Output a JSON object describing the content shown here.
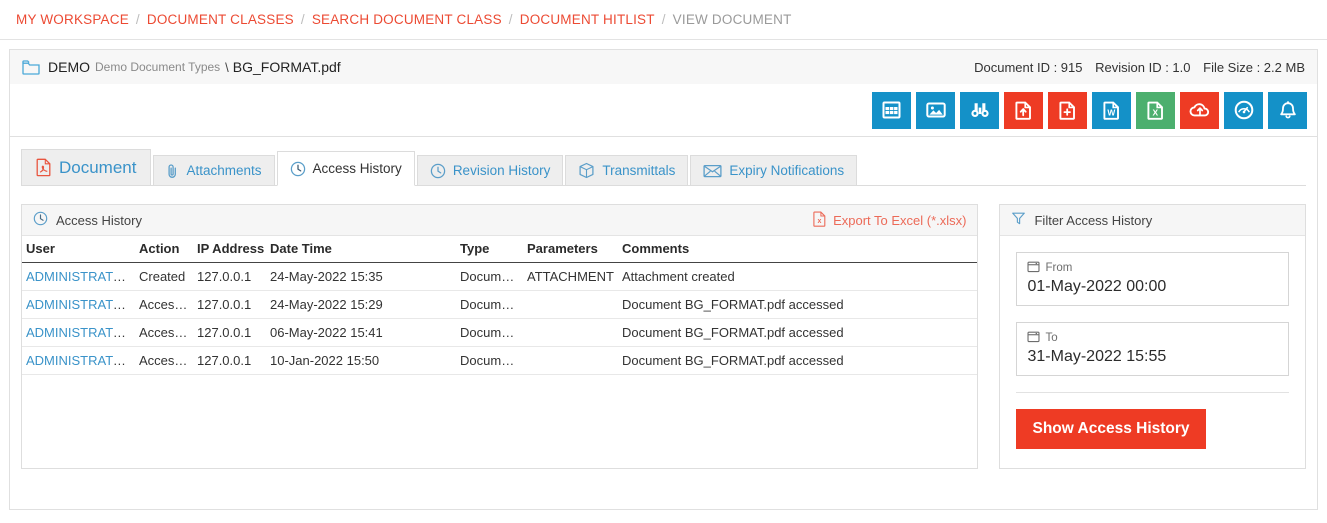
{
  "breadcrumb": {
    "items": [
      {
        "label": "MY WORKSPACE",
        "current": false
      },
      {
        "label": "DOCUMENT CLASSES",
        "current": false
      },
      {
        "label": "SEARCH DOCUMENT CLASS",
        "current": false
      },
      {
        "label": "DOCUMENT HITLIST",
        "current": false
      },
      {
        "label": "VIEW DOCUMENT",
        "current": true
      }
    ],
    "separator": "/"
  },
  "doc_header": {
    "folder_icon": "folder-icon",
    "class_code": "DEMO",
    "class_name": "Demo Document Types",
    "separator": "\\",
    "file_name": "BG_FORMAT.pdf",
    "document_id_label": "Document ID : 915",
    "revision_id_label": "Revision ID : 1.0",
    "file_size_label": "File Size : 2.2 MB"
  },
  "toolbar": {
    "buttons": [
      {
        "name": "table-grid-icon",
        "color": "#1491c8"
      },
      {
        "name": "image-icon",
        "color": "#1491c8"
      },
      {
        "name": "binoculars-icon",
        "color": "#1491c8"
      },
      {
        "name": "file-upload-icon",
        "color": "#ee3b24"
      },
      {
        "name": "file-add-icon",
        "color": "#ee3b24"
      },
      {
        "name": "word-file-icon",
        "color": "#1491c8"
      },
      {
        "name": "excel-file-icon",
        "color": "#4caf6e"
      },
      {
        "name": "cloud-upload-icon",
        "color": "#ee3b24"
      },
      {
        "name": "dashboard-gauge-icon",
        "color": "#1491c8"
      },
      {
        "name": "bell-icon",
        "color": "#1491c8"
      }
    ]
  },
  "tabs": [
    {
      "label": "Document",
      "icon": "pdf-file-icon",
      "active": false,
      "big": true
    },
    {
      "label": "Attachments",
      "icon": "paperclip-icon",
      "active": false,
      "big": false
    },
    {
      "label": "Access History",
      "icon": "clock-icon",
      "active": true,
      "big": false
    },
    {
      "label": "Revision History",
      "icon": "clock-icon",
      "active": false,
      "big": false
    },
    {
      "label": "Transmittals",
      "icon": "box-icon",
      "active": false,
      "big": false
    },
    {
      "label": "Expiry Notifications",
      "icon": "envelope-icon",
      "active": false,
      "big": false
    }
  ],
  "access_history": {
    "panel_title": "Access History",
    "panel_icon": "clock-icon",
    "export_label": "Export To Excel (*.xlsx)",
    "export_icon": "excel-file-icon",
    "columns": [
      "User",
      "Action",
      "IP Address",
      "Date Time",
      "Type",
      "Parameters",
      "Comments"
    ],
    "rows": [
      {
        "user": "ADMINISTRATOR",
        "action": "Created",
        "ip": "127.0.0.1",
        "date_time": "24-May-2022 15:35",
        "type": "Document",
        "parameters": "ATTACHMENT",
        "comments": "Attachment created"
      },
      {
        "user": "ADMINISTRATOR",
        "action": "Accessed",
        "ip": "127.0.0.1",
        "date_time": "24-May-2022 15:29",
        "type": "Document",
        "parameters": "",
        "comments": "Document BG_FORMAT.pdf accessed"
      },
      {
        "user": "ADMINISTRATOR",
        "action": "Accessed",
        "ip": "127.0.0.1",
        "date_time": "06-May-2022 15:41",
        "type": "Document",
        "parameters": "",
        "comments": "Document BG_FORMAT.pdf accessed"
      },
      {
        "user": "ADMINISTRATOR",
        "action": "Accessed",
        "ip": "127.0.0.1",
        "date_time": "10-Jan-2022 15:50",
        "type": "Document",
        "parameters": "",
        "comments": "Document BG_FORMAT.pdf accessed"
      }
    ]
  },
  "filter": {
    "panel_title": "Filter Access History",
    "panel_icon": "funnel-icon",
    "from_label": "From",
    "from_value": "01-May-2022 00:00",
    "to_label": "To",
    "to_value": "31-May-2022 15:55",
    "submit_label": "Show Access History",
    "calendar_icon": "calendar-icon"
  },
  "colors": {
    "accent_red": "#ee3b24",
    "link_red": "#ec4a33",
    "link_blue": "#3a93c9",
    "tile_blue": "#1491c8",
    "tile_green": "#4caf6e"
  }
}
